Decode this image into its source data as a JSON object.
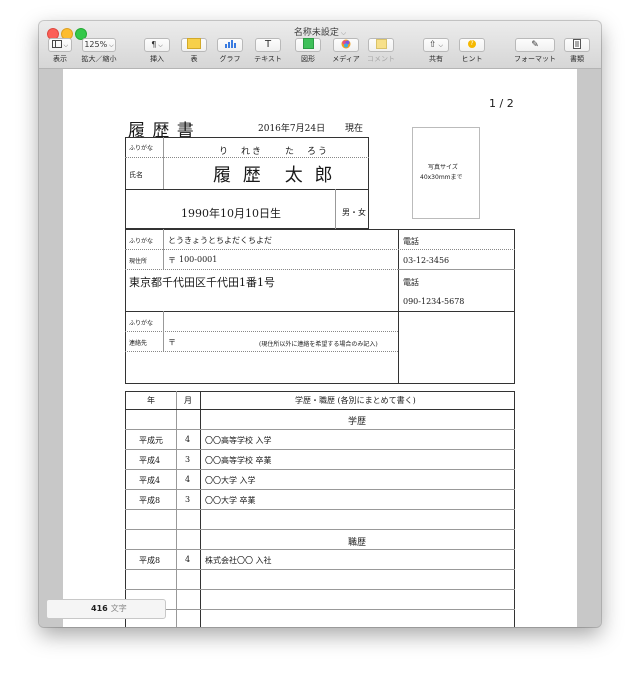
{
  "window": {
    "title": "名称未設定"
  },
  "toolbar": {
    "view": {
      "label": "表示"
    },
    "zoom": {
      "value": "125%",
      "label": "拡大／縮小"
    },
    "insert": {
      "label": "挿入"
    },
    "table": {
      "label": "表"
    },
    "chart": {
      "label": "グラフ"
    },
    "text": {
      "label": "テキスト"
    },
    "shape": {
      "label": "図形"
    },
    "media": {
      "label": "メディア"
    },
    "comment": {
      "label": "コメント"
    },
    "share": {
      "label": "共有"
    },
    "tips": {
      "label": "ヒント"
    },
    "format": {
      "label": "フォーマット"
    },
    "document": {
      "label": "書類"
    }
  },
  "page_number": "1 / 2",
  "resume": {
    "title": "履 歴 書",
    "date": "2016年7月24日",
    "date_suffix": "現在",
    "furigana_label": "ふりがな",
    "furigana_name": "り　れき　　た　ろう",
    "name_label": "氏名",
    "name": "履 歴　太 郎",
    "birthdate": "1990年10月10日生",
    "gender": "男・女",
    "photo_line1": "写真サイズ",
    "photo_line2": "40x30mmまで",
    "address_furigana_label": "ふりがな",
    "address_furigana": "とうきょうとちよだくちよだ",
    "address_label": "現住所",
    "postal_mark": "〒",
    "postal_code": "100-0001",
    "address": "東京都千代田区千代田1番1号",
    "phone_label": "電話",
    "phone": "03-12-3456",
    "phone2_label": "電話",
    "phone2": "090-1234-5678",
    "contact_furigana_label": "ふりがな",
    "contact_label": "連絡先",
    "contact_postal_mark": "〒",
    "contact_note": "(現住所以外に連絡を希望する場合のみ記入)"
  },
  "history": {
    "col_year": "年",
    "col_month": "月",
    "col_detail": "学歴・職歴 (各別にまとめて書く)",
    "education_heading": "学歴",
    "education": [
      {
        "year": "平成元",
        "month": "4",
        "detail": "〇〇高等学校 入学"
      },
      {
        "year": "平成4",
        "month": "3",
        "detail": "〇〇高等学校 卒業"
      },
      {
        "year": "平成4",
        "month": "4",
        "detail": "〇〇大学 入学"
      },
      {
        "year": "平成8",
        "month": "3",
        "detail": "〇〇大学 卒業"
      }
    ],
    "work_heading": "職歴",
    "work": [
      {
        "year": "平成8",
        "month": "4",
        "detail": "株式会社〇〇 入社"
      }
    ]
  },
  "status": {
    "word_count": "416",
    "word_unit": "文字"
  }
}
